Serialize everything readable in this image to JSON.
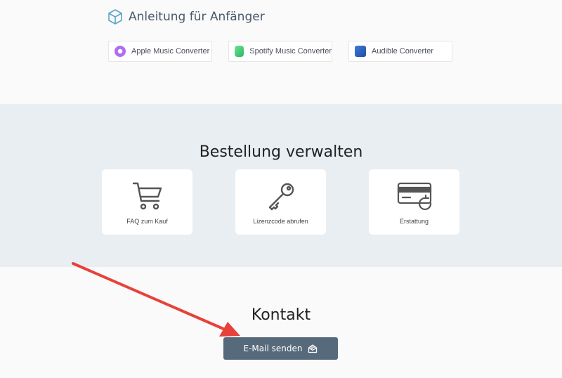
{
  "guide": {
    "title": "Anleitung für Anfänger",
    "products": [
      {
        "label": "Apple Music Converter",
        "icon": "apple-music-converter-icon"
      },
      {
        "label": "Spotify Music Converter",
        "icon": "spotify-music-converter-icon"
      },
      {
        "label": "Audible Converter",
        "icon": "audible-converter-icon"
      }
    ]
  },
  "order": {
    "title": "Bestellung verwalten",
    "cards": [
      {
        "label": "FAQ zum Kauf",
        "icon": "shopping-cart-icon"
      },
      {
        "label": "Lizenzcode abrufen",
        "icon": "key-icon"
      },
      {
        "label": "Erstattung",
        "icon": "refund-card-icon"
      }
    ]
  },
  "contact": {
    "title": "Kontakt",
    "email_label": "E-Mail senden"
  },
  "colors": {
    "button": "#566a7c",
    "section_bg": "#e9eef2",
    "annotation_arrow": "#e8403a"
  }
}
